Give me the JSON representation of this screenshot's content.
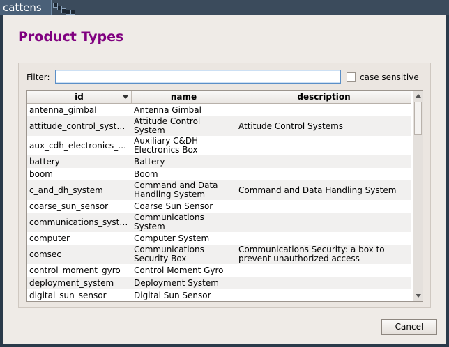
{
  "window": {
    "title": "cattens"
  },
  "dialog": {
    "heading": "Product Types",
    "filter_label": "Filter:",
    "filter_value": "",
    "case_sensitive_label": "case sensitive",
    "cancel_label": "Cancel"
  },
  "table": {
    "columns": [
      "id",
      "name",
      "description"
    ],
    "rows": [
      {
        "id": "antenna_gimbal",
        "name": "Antenna Gimbal",
        "description": ""
      },
      {
        "id": "attitude_control_syst…",
        "name": "Attitude Control\nSystem",
        "description": "Attitude Control Systems"
      },
      {
        "id": "aux_cdh_electronics_…",
        "name": "Auxiliary C&DH\nElectronics Box",
        "description": ""
      },
      {
        "id": "battery",
        "name": "Battery",
        "description": ""
      },
      {
        "id": "boom",
        "name": "Boom",
        "description": ""
      },
      {
        "id": "c_and_dh_system",
        "name": "Command and Data\nHandling System",
        "description": "Command and Data Handling System"
      },
      {
        "id": "coarse_sun_sensor",
        "name": "Coarse Sun Sensor",
        "description": ""
      },
      {
        "id": "communications_syst…",
        "name": "Communications\nSystem",
        "description": ""
      },
      {
        "id": "computer",
        "name": "Computer System",
        "description": ""
      },
      {
        "id": "comsec",
        "name": "Communications\nSecurity Box",
        "description": "Communications Security: a box to\nprevent unauthorized access"
      },
      {
        "id": "control_moment_gyro",
        "name": "Control Moment Gyro",
        "description": ""
      },
      {
        "id": "deployment_system",
        "name": "Deployment System",
        "description": ""
      },
      {
        "id": "digital_sun_sensor",
        "name": "Digital Sun Sensor",
        "description": ""
      }
    ]
  },
  "colors": {
    "heading": "#800080",
    "focus_border": "#5b8fc7"
  }
}
